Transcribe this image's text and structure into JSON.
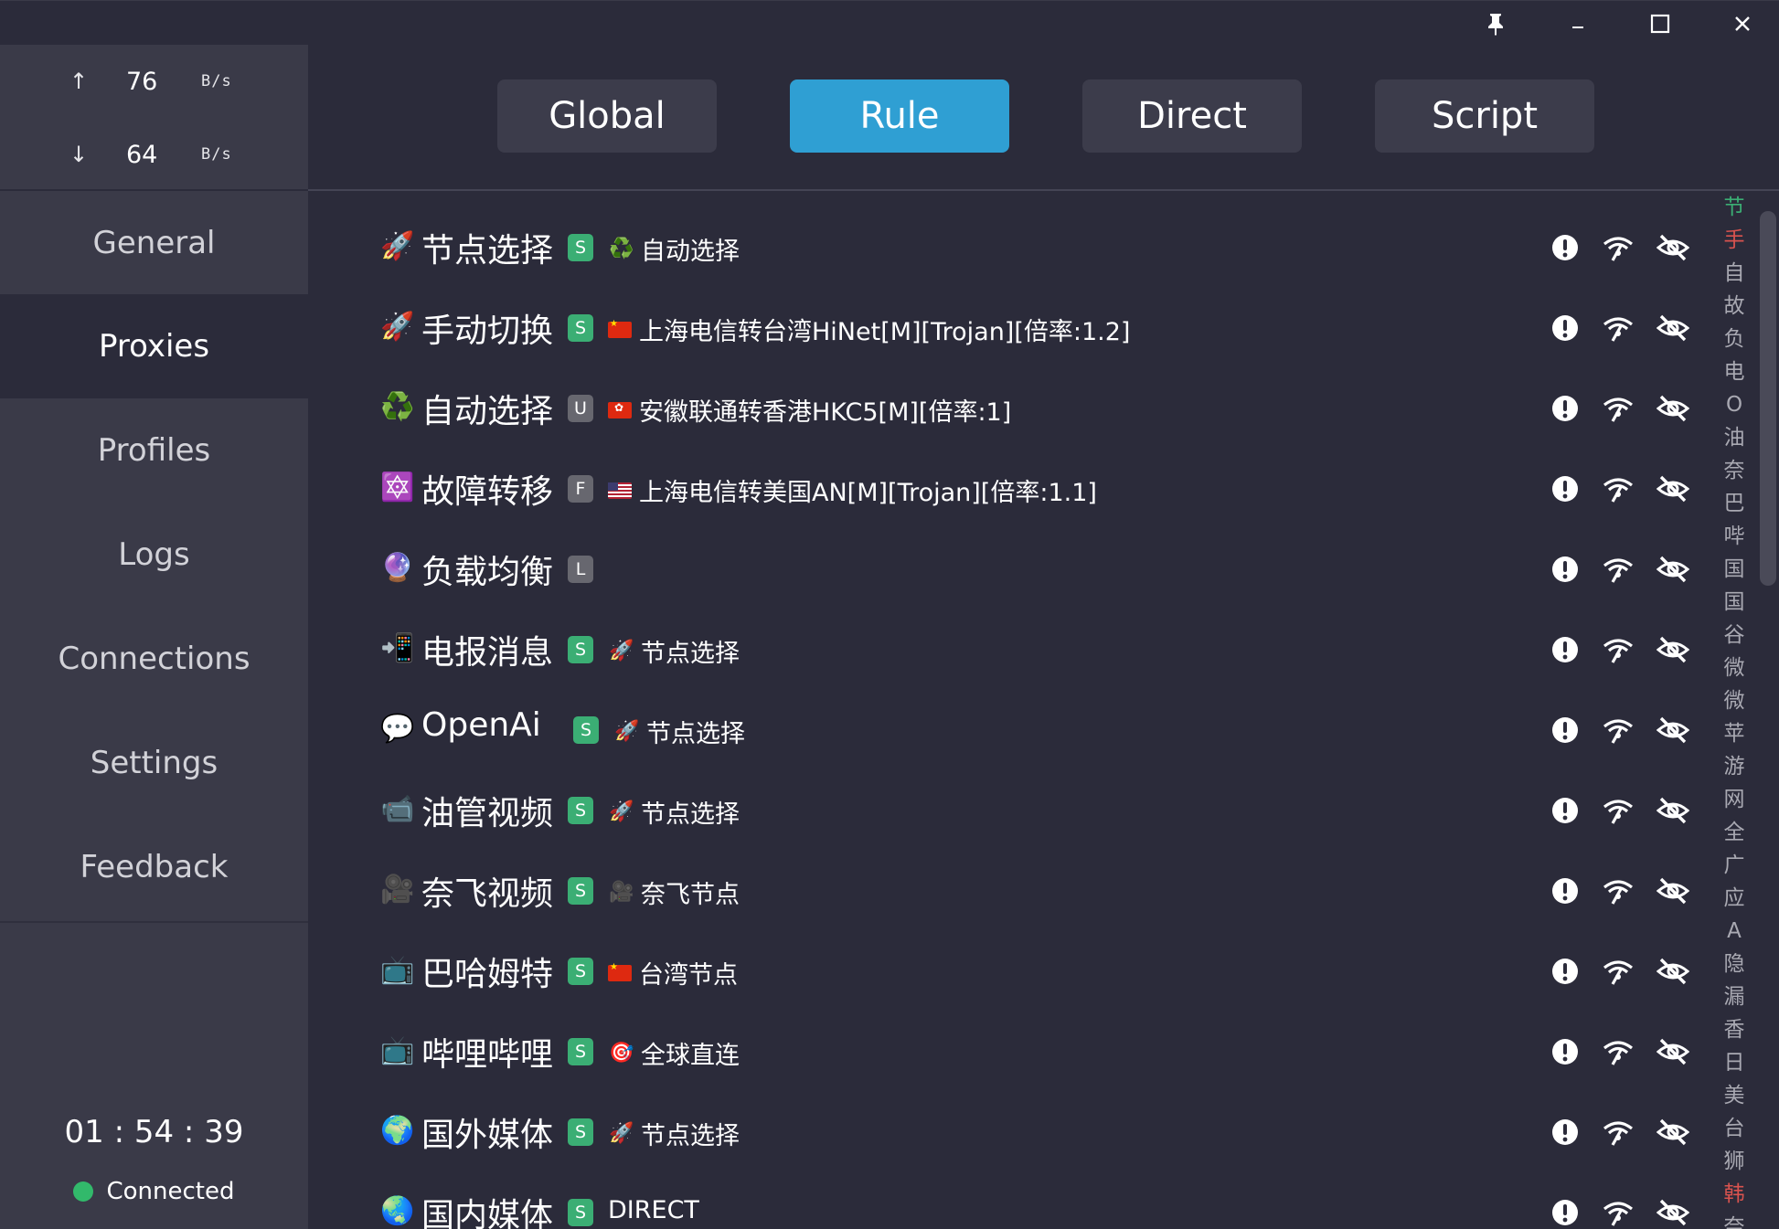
{
  "window": {
    "pin_icon": "pin-icon",
    "controls": [
      "minimize-icon",
      "maximize-icon",
      "close-icon"
    ]
  },
  "traffic": {
    "up_arrow": "↑",
    "up_value": "76",
    "up_unit": "B/s",
    "down_arrow": "↓",
    "down_value": "64",
    "down_unit": "B/s"
  },
  "nav": [
    {
      "label": "General",
      "active": false
    },
    {
      "label": "Proxies",
      "active": true
    },
    {
      "label": "Profiles",
      "active": false
    },
    {
      "label": "Logs",
      "active": false
    },
    {
      "label": "Connections",
      "active": false
    },
    {
      "label": "Settings",
      "active": false
    },
    {
      "label": "Feedback",
      "active": false
    }
  ],
  "footer": {
    "uptime": "01 : 54 : 39",
    "status": "Connected",
    "status_color": "#32b96b"
  },
  "modes": {
    "items": [
      "Global",
      "Rule",
      "Direct",
      "Script"
    ],
    "selected": "Rule",
    "accent": "#2f9fd3"
  },
  "groups": [
    {
      "icon": "🚀",
      "name": "节点选择",
      "type": "S",
      "sel_icon": "♻️",
      "sel_flag": "",
      "selected": "自动选择"
    },
    {
      "icon": "🚀",
      "name": "手动切换",
      "type": "S",
      "sel_icon": "",
      "sel_flag": "cn",
      "selected": "上海电信转台湾HiNet[M][Trojan][倍率:1.2]"
    },
    {
      "icon": "♻️",
      "name": "自动选择",
      "type": "U",
      "sel_icon": "",
      "sel_flag": "hk",
      "selected": "安徽联通转香港HKC5[M][倍率:1]"
    },
    {
      "icon": "🔯",
      "name": "故障转移",
      "type": "F",
      "sel_icon": "",
      "sel_flag": "us",
      "selected": "上海电信转美国AN[M][Trojan][倍率:1.1]"
    },
    {
      "icon": "🔮",
      "name": "负载均衡",
      "type": "L",
      "sel_icon": "",
      "sel_flag": "",
      "selected": ""
    },
    {
      "icon": "📲",
      "name": "电报消息",
      "type": "S",
      "sel_icon": "🚀",
      "sel_flag": "",
      "selected": "节点选择"
    },
    {
      "icon": "💬",
      "name": "OpenAi",
      "type": "S",
      "sel_icon": "🚀",
      "sel_flag": "",
      "selected": "节点选择"
    },
    {
      "icon": "📹",
      "name": "油管视频",
      "type": "S",
      "sel_icon": "🚀",
      "sel_flag": "",
      "selected": "节点选择"
    },
    {
      "icon": "🎥",
      "name": "奈飞视频",
      "type": "S",
      "sel_icon": "🎥",
      "sel_flag": "",
      "selected": "奈飞节点"
    },
    {
      "icon": "📺",
      "name": "巴哈姆特",
      "type": "S",
      "sel_icon": "",
      "sel_flag": "cn",
      "selected": "台湾节点"
    },
    {
      "icon": "📺",
      "name": "哔哩哔哩",
      "type": "S",
      "sel_icon": "🎯",
      "sel_flag": "",
      "selected": "全球直连"
    },
    {
      "icon": "🌍",
      "name": "国外媒体",
      "type": "S",
      "sel_icon": "🚀",
      "sel_flag": "",
      "selected": "节点选择"
    },
    {
      "icon": "🌏",
      "name": "国内媒体",
      "type": "S",
      "sel_icon": "",
      "sel_flag": "",
      "selected": "DIRECT"
    }
  ],
  "row_actions": [
    "alert-icon",
    "wifi-test-icon",
    "eye-off-icon"
  ],
  "index_bar": [
    {
      "char": "节",
      "color": "#3bae74"
    },
    {
      "char": "手",
      "color": "#d9534f"
    },
    {
      "char": "自",
      "color": "#a9a9b2"
    },
    {
      "char": "故",
      "color": "#a9a9b2"
    },
    {
      "char": "负",
      "color": "#a9a9b2"
    },
    {
      "char": "电",
      "color": "#a9a9b2"
    },
    {
      "char": "O",
      "color": "#a9a9b2"
    },
    {
      "char": "油",
      "color": "#a9a9b2"
    },
    {
      "char": "奈",
      "color": "#a9a9b2"
    },
    {
      "char": "巴",
      "color": "#a9a9b2"
    },
    {
      "char": "哔",
      "color": "#a9a9b2"
    },
    {
      "char": "国",
      "color": "#a9a9b2"
    },
    {
      "char": "国",
      "color": "#a9a9b2"
    },
    {
      "char": "谷",
      "color": "#a9a9b2"
    },
    {
      "char": "微",
      "color": "#a9a9b2"
    },
    {
      "char": "微",
      "color": "#a9a9b2"
    },
    {
      "char": "苹",
      "color": "#a9a9b2"
    },
    {
      "char": "游",
      "color": "#a9a9b2"
    },
    {
      "char": "网",
      "color": "#a9a9b2"
    },
    {
      "char": "全",
      "color": "#a9a9b2"
    },
    {
      "char": "广",
      "color": "#a9a9b2"
    },
    {
      "char": "应",
      "color": "#a9a9b2"
    },
    {
      "char": "A",
      "color": "#a9a9b2"
    },
    {
      "char": "隐",
      "color": "#a9a9b2"
    },
    {
      "char": "漏",
      "color": "#a9a9b2"
    },
    {
      "char": "香",
      "color": "#a9a9b2"
    },
    {
      "char": "日",
      "color": "#a9a9b2"
    },
    {
      "char": "美",
      "color": "#a9a9b2"
    },
    {
      "char": "台",
      "color": "#a9a9b2"
    },
    {
      "char": "狮",
      "color": "#a9a9b2"
    },
    {
      "char": "韩",
      "color": "#d9534f"
    },
    {
      "char": "奈",
      "color": "#a9a9b2"
    }
  ]
}
